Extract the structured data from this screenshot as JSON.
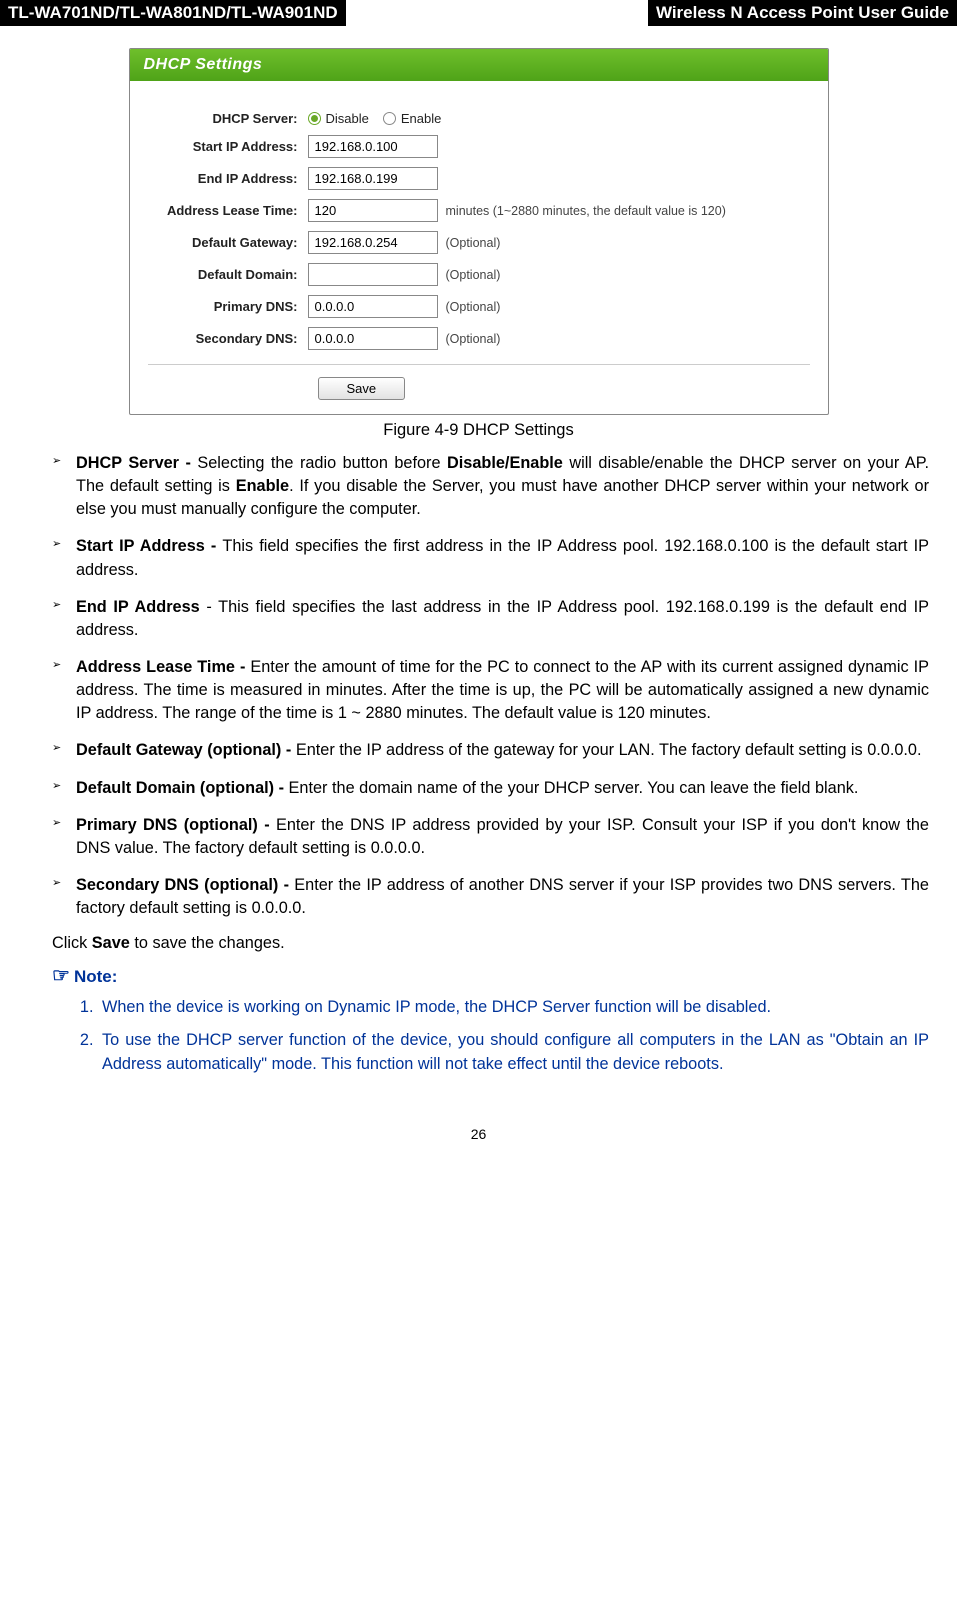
{
  "header": {
    "left": "TL-WA701ND/TL-WA801ND/TL-WA901ND",
    "right": "Wireless N Access Point User Guide"
  },
  "panel": {
    "title": "DHCP Settings",
    "rows": {
      "dhcp_server_label": "DHCP Server:",
      "disable_label": "Disable",
      "enable_label": "Enable",
      "start_ip_label": "Start IP Address:",
      "start_ip_value": "192.168.0.100",
      "end_ip_label": "End IP Address:",
      "end_ip_value": "192.168.0.199",
      "lease_label": "Address Lease Time:",
      "lease_value": "120",
      "lease_hint": "minutes (1~2880 minutes, the default value is 120)",
      "gateway_label": "Default Gateway:",
      "gateway_value": "192.168.0.254",
      "optional": "(Optional)",
      "domain_label": "Default Domain:",
      "domain_value": "",
      "pdns_label": "Primary DNS:",
      "pdns_value": "0.0.0.0",
      "sdns_label": "Secondary DNS:",
      "sdns_value": "0.0.0.0",
      "save": "Save"
    }
  },
  "figure_caption": "Figure 4-9 DHCP Settings",
  "bullets": {
    "b1_strong": "DHCP Server - ",
    "b1_pre": "Selecting the radio button before ",
    "b1_mid_bold": "Disable/Enable",
    "b1_mid": " will disable/enable the DHCP server on your AP. The default setting is ",
    "b1_enable_bold": "Enable",
    "b1_tail": ". If you disable the Server, you must have another DHCP server within your network or else you must manually configure the computer.",
    "b2_strong": "Start IP Address - ",
    "b2_text": "This field specifies the first address in the IP Address pool. 192.168.0.100 is the default start IP address.",
    "b3_strong": "End IP Address",
    "b3_text": " - This field specifies the last address in the IP Address pool. 192.168.0.199 is the default end IP address.",
    "b4_strong": "Address Lease Time - ",
    "b4_text": "Enter the amount of time for the PC to connect to the AP with its current assigned dynamic IP address. The time is measured in minutes. After the time is up, the PC will be automatically assigned a new dynamic IP address. The range of the time is 1 ~ 2880 minutes. The default value is 120 minutes.",
    "b5_strong": "Default Gateway (optional) - ",
    "b5_text": "Enter the IP address of the gateway for your LAN. The factory default setting is 0.0.0.0.",
    "b6_strong": "Default Domain (optional) - ",
    "b6_text": "Enter the domain name of the your DHCP server. You can leave the field blank.",
    "b7_strong": "Primary DNS (optional) - ",
    "b7_text": "Enter the DNS IP address provided by your ISP. Consult your ISP if you don't know the DNS value. The factory default setting is 0.0.0.0.",
    "b8_strong": "Secondary DNS (optional) - ",
    "b8_text": "Enter the IP address of another DNS server if your ISP provides two DNS servers. The factory default setting is 0.0.0.0."
  },
  "click_save_pre": "Click ",
  "click_save_bold": "Save",
  "click_save_post": " to save the changes.",
  "note_label": "Note:",
  "notes": {
    "n1": "When the device is working on Dynamic IP mode, the DHCP Server function will be disabled.",
    "n2": "To use the DHCP server function of the device, you should configure all computers in the LAN as \"Obtain an IP Address automatically\" mode. This function will not take effect until the device reboots."
  },
  "page_number": "26"
}
